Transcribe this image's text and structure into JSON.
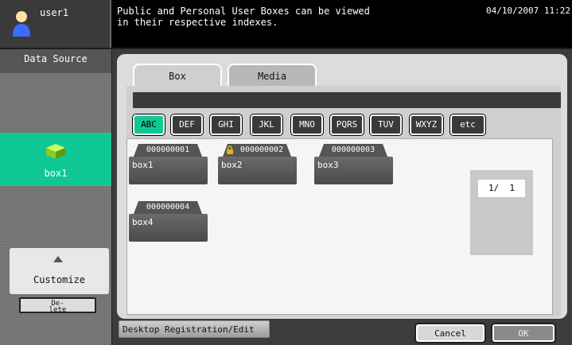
{
  "topbar": {
    "user": "user1",
    "message": "Public and Personal User Boxes can be viewed\nin their respective indexes.",
    "datetime": "04/10/2007 11:22"
  },
  "left": {
    "data_source_label": "Data Source",
    "selected_source": "box1",
    "customize_label": "Customize",
    "delete_label": "De-\nlete"
  },
  "tabs": [
    {
      "label": "Box"
    },
    {
      "label": "Media"
    }
  ],
  "index_buttons": [
    "ABC",
    "DEF",
    "GHI",
    "JKL",
    "MNO",
    "PQRS",
    "TUV",
    "WXYZ",
    "etc"
  ],
  "selected_index": "ABC",
  "boxes": [
    {
      "number": "000000001",
      "name": "box1",
      "locked": false
    },
    {
      "number": "000000002",
      "name": "box2",
      "locked": true
    },
    {
      "number": "000000003",
      "name": "box3",
      "locked": false
    },
    {
      "number": "000000004",
      "name": "box4",
      "locked": false
    }
  ],
  "pager": {
    "text": "1/  1"
  },
  "bottom": {
    "desktop_label": "Desktop Registration/Edit",
    "cancel_label": "Cancel",
    "ok_label": "OK"
  },
  "colors": {
    "accent": "#10c896"
  }
}
